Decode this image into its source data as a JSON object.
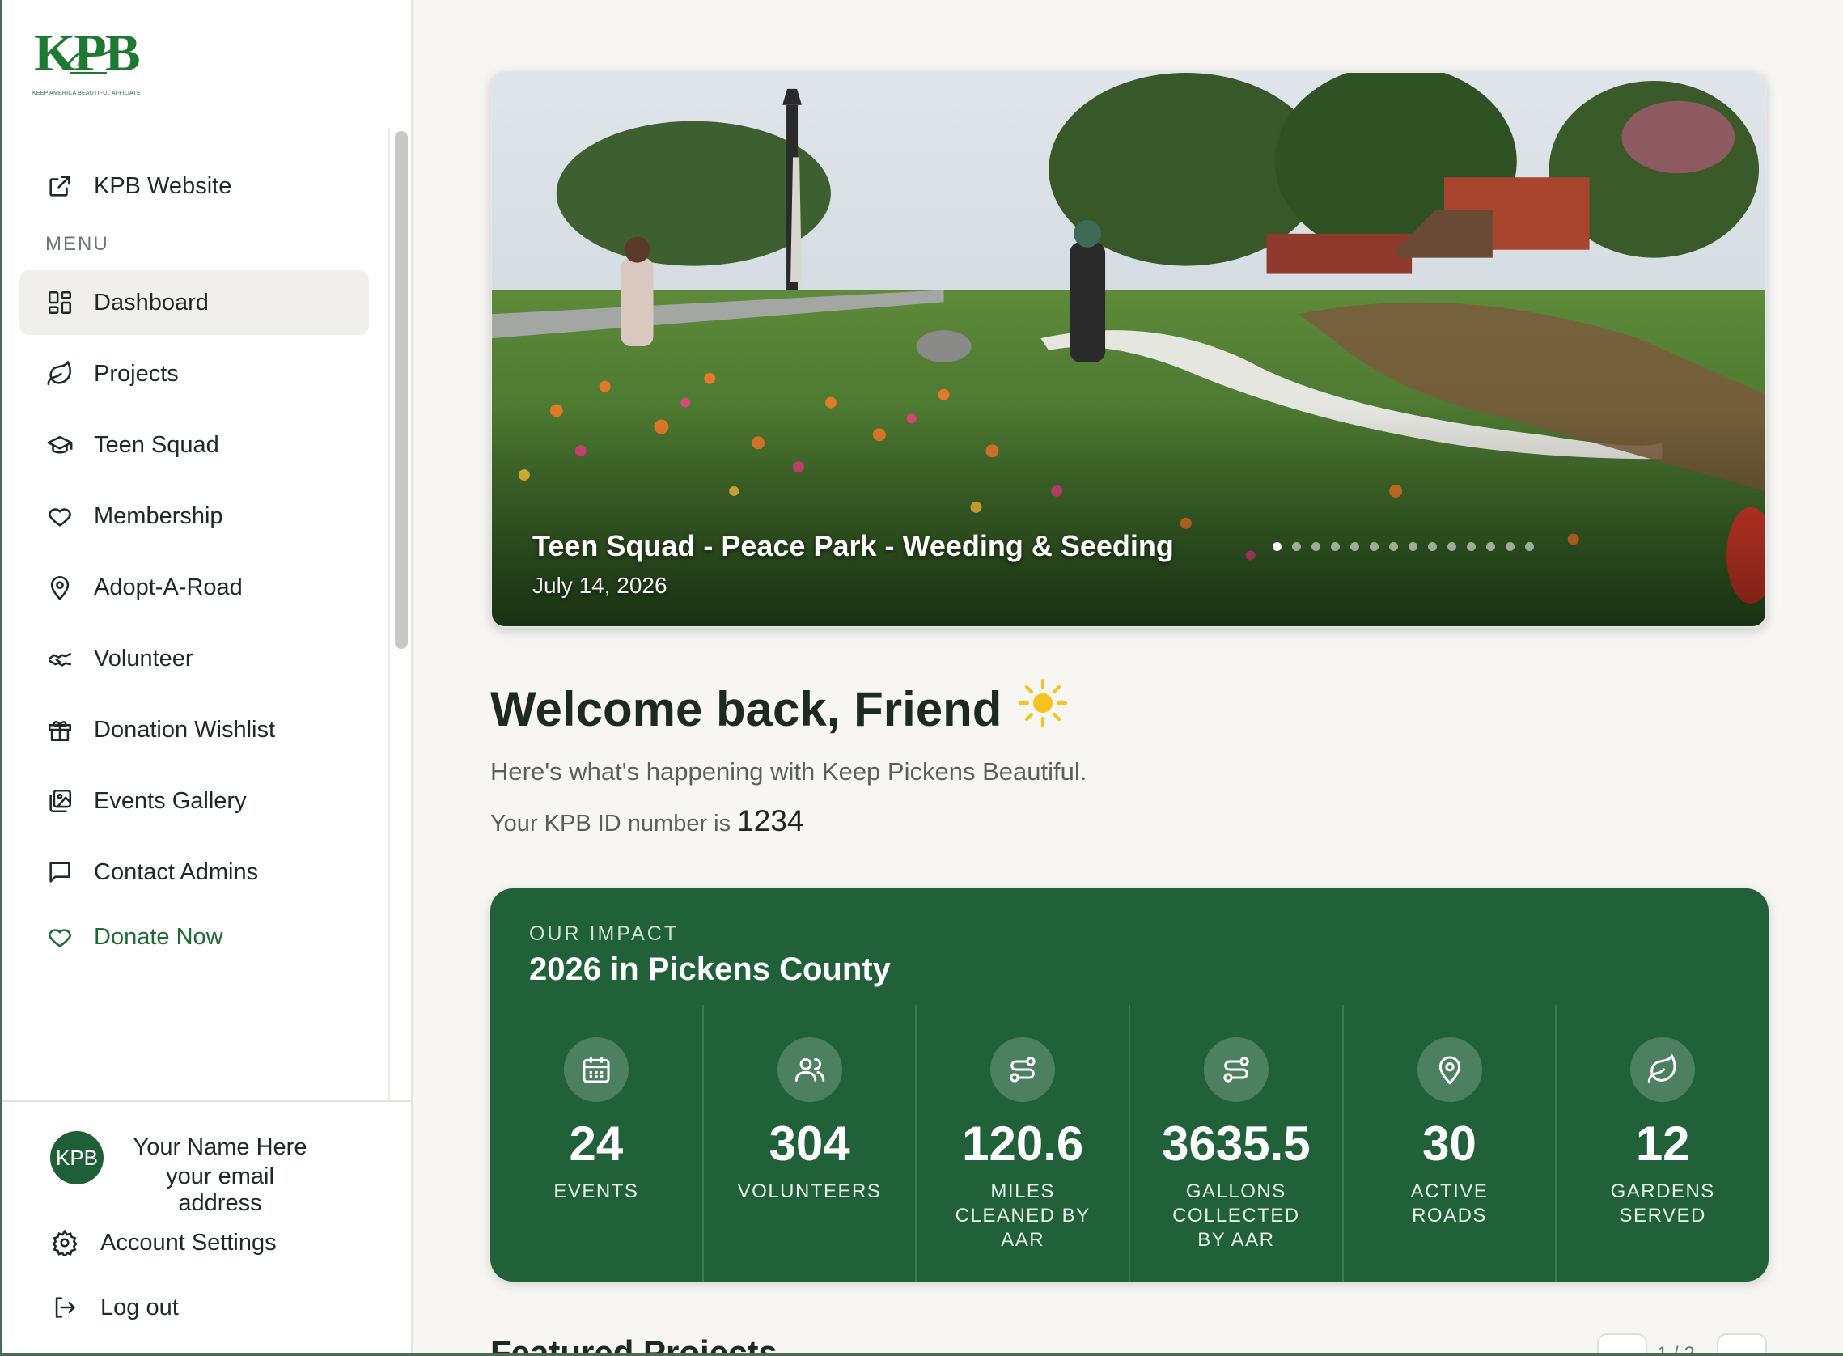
{
  "logo": {
    "wordmark": "KPB",
    "tagline": "KEEP AMERICA BEAUTIFUL AFFILIATE"
  },
  "sidebar": {
    "external_link": {
      "label": "KPB Website",
      "icon": "external-link-icon"
    },
    "menu_label": "MENU",
    "items": [
      {
        "label": "Dashboard",
        "icon": "dashboard-icon",
        "active": true
      },
      {
        "label": "Projects",
        "icon": "leaf-icon"
      },
      {
        "label": "Teen Squad",
        "icon": "graduation-cap-icon"
      },
      {
        "label": "Membership",
        "icon": "heart-icon"
      },
      {
        "label": "Adopt-A-Road",
        "icon": "map-pin-icon"
      },
      {
        "label": "Volunteer",
        "icon": "handshake-icon"
      },
      {
        "label": "Donation Wishlist",
        "icon": "gift-icon"
      },
      {
        "label": "Events Gallery",
        "icon": "gallery-icon"
      },
      {
        "label": "Contact Admins",
        "icon": "chat-icon"
      }
    ],
    "donate": {
      "label": "Donate Now",
      "icon": "heart-icon",
      "color": "#1e6a35"
    }
  },
  "user": {
    "avatar": "KPB",
    "name": "Your Name Here",
    "email": "your email address",
    "account_settings": "Account Settings",
    "logout": "Log out"
  },
  "hero": {
    "title": "Teen Squad - Peace Park - Weeding & Seeding",
    "date": "July 14, 2026",
    "slide_count": 14,
    "active_slide": 1
  },
  "welcome": {
    "heading": "Welcome back, Friend",
    "emoji": "☀️",
    "subtitle": "Here's what's happening with Keep Pickens Beautiful.",
    "id_prefix": "Your KPB ID number is",
    "id_number": "1234"
  },
  "impact": {
    "kicker": "OUR IMPACT",
    "title": "2026 in Pickens County",
    "background": "#206139",
    "stats": [
      {
        "value": "24",
        "label": "EVENTS",
        "icon": "calendar-icon"
      },
      {
        "value": "304",
        "label": "VOLUNTEERS",
        "icon": "users-icon"
      },
      {
        "value": "120.6",
        "label": "MILES CLEANED BY AAR",
        "icon": "route-icon"
      },
      {
        "value": "3635.5",
        "label": "GALLONS COLLECTED BY AAR",
        "icon": "route-icon"
      },
      {
        "value": "30",
        "label": "ACTIVE ROADS",
        "icon": "map-pin-icon"
      },
      {
        "value": "12",
        "label": "GARDENS SERVED",
        "icon": "leaf-icon"
      }
    ]
  },
  "featured": {
    "title": "Featured Projects",
    "pager": "1 / 2"
  }
}
